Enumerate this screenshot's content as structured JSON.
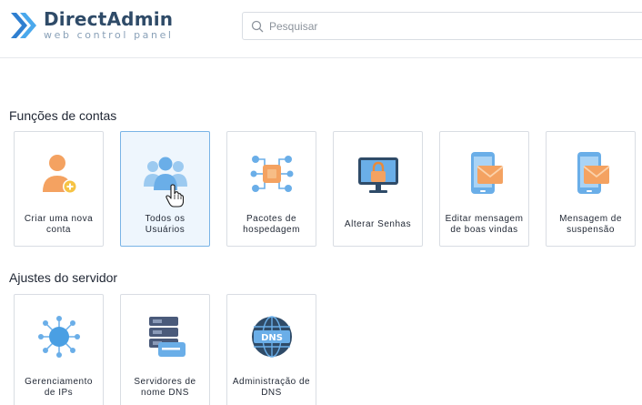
{
  "brand": {
    "title": "DirectAdmin",
    "subtitle": "web control panel"
  },
  "search": {
    "placeholder": "Pesquisar"
  },
  "sections": [
    {
      "title": "Funções de contas",
      "cards": [
        {
          "label": "Criar uma nova conta",
          "icon": "add-user-icon"
        },
        {
          "label": "Todos os Usuários",
          "icon": "users-group-icon",
          "active": true
        },
        {
          "label": "Pacotes de hospedagem",
          "icon": "package-network-icon"
        },
        {
          "label": "Alterar Senhas",
          "icon": "monitor-lock-icon"
        },
        {
          "label": "Editar mensagem de boas vindas",
          "icon": "phone-mail-icon"
        },
        {
          "label": "Mensagem de suspensão",
          "icon": "phone-mail-icon"
        }
      ]
    },
    {
      "title": "Ajustes do servidor",
      "cards": [
        {
          "label": "Gerenciamento de IPs",
          "icon": "ip-network-icon"
        },
        {
          "label": "Servidores de nome DNS",
          "icon": "server-stack-icon"
        },
        {
          "label": "Administração de DNS",
          "icon": "dns-globe-icon"
        }
      ]
    }
  ],
  "colors": {
    "accent": "#4a9fe3",
    "orange": "#f4a261",
    "navy": "#2f4b68"
  }
}
